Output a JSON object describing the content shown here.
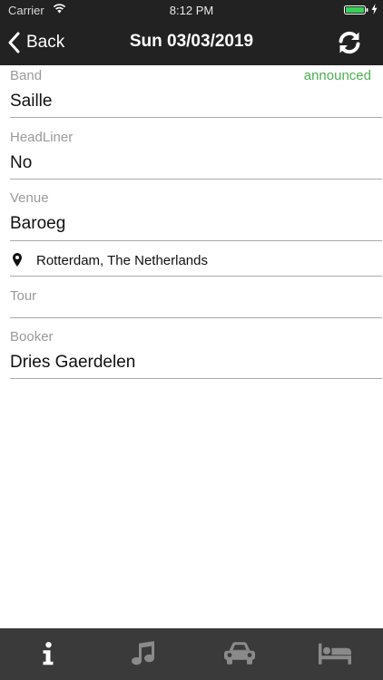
{
  "status_bar": {
    "carrier": "Carrier",
    "time": "8:12 PM",
    "battery_color": "#35d158"
  },
  "nav": {
    "back_label": "Back",
    "title": "Sun 03/03/2019",
    "refresh_icon": "refresh-icon"
  },
  "status_badge": {
    "text": "announced",
    "color": "#4caf50"
  },
  "fields": {
    "band": {
      "label": "Band",
      "value": "Saille"
    },
    "headliner": {
      "label": "HeadLiner",
      "value": "No"
    },
    "venue": {
      "label": "Venue",
      "value": "Baroeg"
    },
    "location": {
      "icon": "map-pin-icon",
      "value": "Rotterdam, The Netherlands"
    },
    "tour": {
      "label": "Tour",
      "value": ""
    },
    "booker": {
      "label": "Booker",
      "value": "Dries Gaerdelen"
    }
  },
  "tabs": [
    {
      "icon": "info-icon",
      "active": true
    },
    {
      "icon": "music-note-icon",
      "active": false
    },
    {
      "icon": "car-icon",
      "active": false
    },
    {
      "icon": "bed-icon",
      "active": false
    }
  ],
  "colors": {
    "nav_background": "#222222",
    "tab_background": "#3a3a3a",
    "tab_active": "#ffffff",
    "tab_inactive": "#8a8a8a",
    "label": "#9a9a9a"
  }
}
